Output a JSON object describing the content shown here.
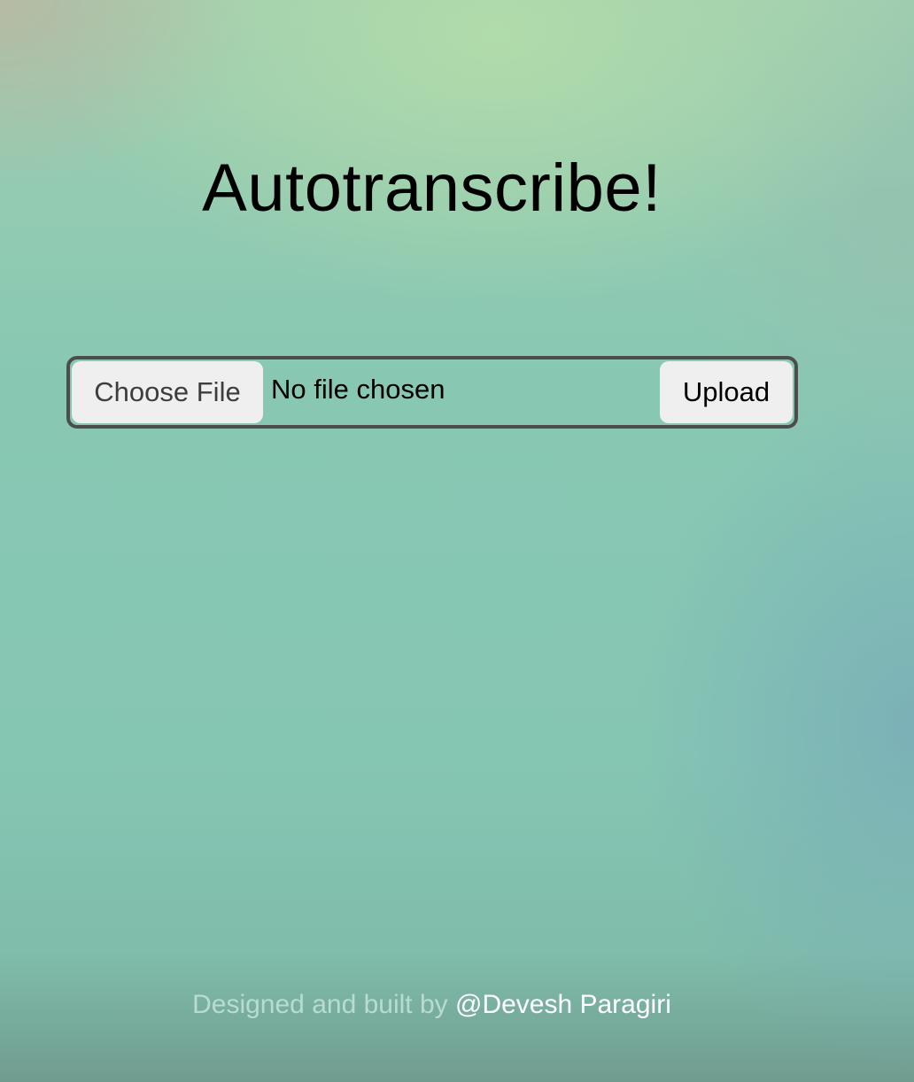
{
  "app": {
    "title": "Autotranscribe!"
  },
  "upload_form": {
    "choose_file_label": "Choose File",
    "file_status": "No file chosen",
    "upload_label": "Upload"
  },
  "footer": {
    "prefix": "Designed and built by",
    "author_link": "@Devesh Paragiri"
  },
  "colors": {
    "text": "#000000",
    "form_border": "#4d4d4d",
    "button_bg": "#efefef",
    "footer_muted": "#b8dcd0",
    "footer_link": "#ffffff"
  }
}
